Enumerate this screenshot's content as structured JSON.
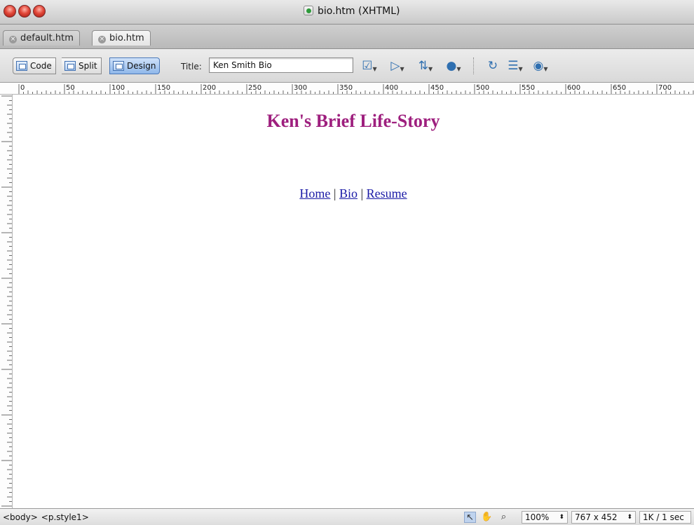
{
  "window": {
    "title": "bio.htm (XHTML)"
  },
  "tabs": [
    {
      "label": "default.htm",
      "active": false
    },
    {
      "label": "bio.htm",
      "active": true
    }
  ],
  "toolbar": {
    "view_buttons": [
      {
        "label": "Code",
        "icon": "code-view-icon",
        "selected": false
      },
      {
        "label": "Split",
        "icon": "split-view-icon",
        "selected": false
      },
      {
        "label": "Design",
        "icon": "design-view-icon",
        "selected": true
      }
    ],
    "title_label": "Title:",
    "title_value": "Ken Smith Bio",
    "icons": [
      "validate-icon",
      "debug-icon",
      "file-transfer-icon",
      "preview-browser-icon",
      "refresh-icon",
      "view-options-icon",
      "visual-aids-icon"
    ]
  },
  "ruler": {
    "labels": [
      "0",
      "50",
      "100",
      "150",
      "200",
      "250",
      "300",
      "350",
      "400",
      "450",
      "500",
      "550",
      "600",
      "650",
      "700"
    ]
  },
  "document": {
    "heading": "Ken's Brief Life-Story",
    "links": [
      {
        "label": "Home"
      },
      {
        "label": "Bio"
      },
      {
        "label": "Resume"
      }
    ],
    "separator": "|"
  },
  "colors": {
    "heading": "#9e1f7e",
    "link": "#1a1aa6",
    "design_button": "#8fb7ea"
  },
  "statusbar": {
    "tags": [
      "<body>",
      "<p.style1>"
    ],
    "zoom": "100%",
    "window_size": "767 x 452",
    "download_stats": "1K / 1 sec"
  }
}
